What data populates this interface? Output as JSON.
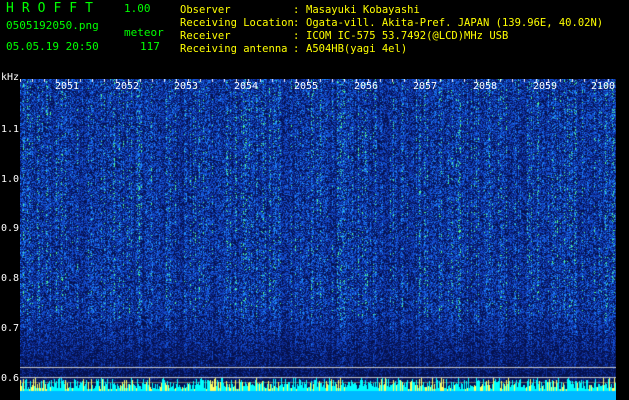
{
  "app": {
    "title": "HROFFT",
    "version": "1.00"
  },
  "file": {
    "name": "0505192050.png",
    "datetime": "05.05.19 20:50",
    "meteor_label": "meteor",
    "meteor_count": "117"
  },
  "info": {
    "labels": [
      "Observer",
      "Receiving Location",
      "Receiver",
      "Receiving antenna"
    ],
    "values": [
      "Masayuki Kobayashi",
      "Ogata-vill. Akita-Pref. JAPAN (139.96E, 40.02N)",
      "ICOM IC-575 53.7492(@LCD)MHz USB",
      "A504HB(yagi 4el)"
    ]
  },
  "axis": {
    "y_unit": "kHz",
    "y_ticks": [
      "1.1",
      "1.0",
      "0.9",
      "0.8",
      "0.7",
      "0.6"
    ],
    "x_ticks": [
      "2051",
      "2052",
      "2053",
      "2054",
      "2055",
      "2056",
      "2057",
      "2058",
      "2059",
      "2100"
    ]
  },
  "colors": {
    "background": "#000000",
    "title": "#00ff00",
    "info_text": "#ffff00",
    "axis_text": "#ffffff",
    "spectrogram_low": "#0a1f6a",
    "spectrogram_mid": "#1a55d8",
    "spectrogram_high": "#33ff99",
    "baseline": "#00ffff"
  }
}
